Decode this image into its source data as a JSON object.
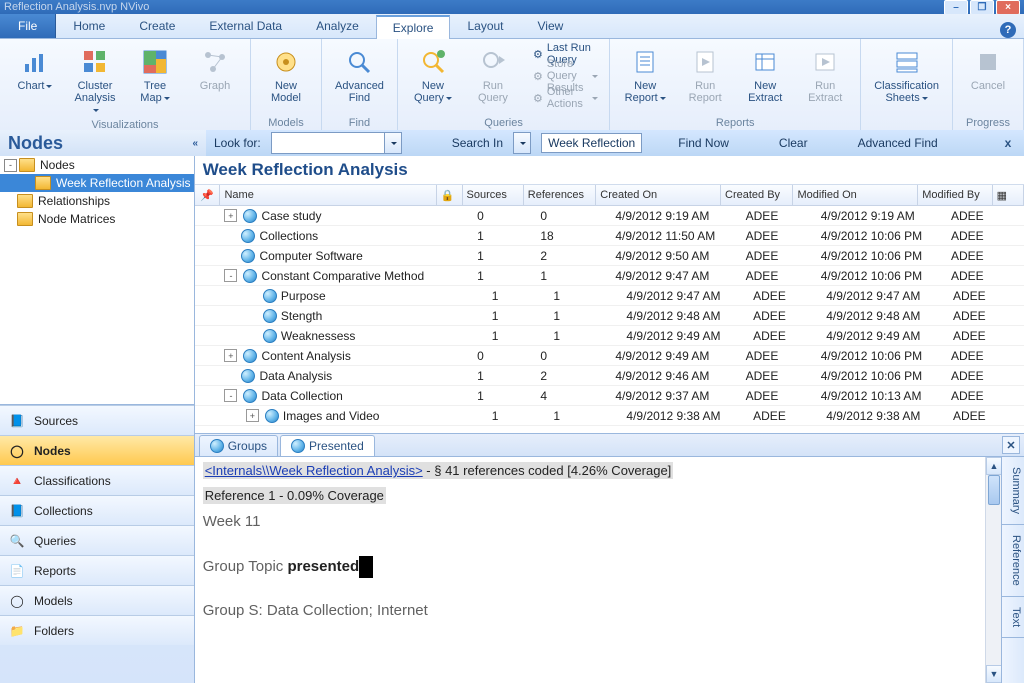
{
  "window": {
    "title_fragment": "Reflection Analysis.nvp   NVivo",
    "min": "–",
    "max": "❐",
    "close": "×"
  },
  "tabs": {
    "file": "File",
    "items": [
      "Home",
      "Create",
      "External Data",
      "Analyze",
      "Explore",
      "Layout",
      "View"
    ],
    "active_index": 4
  },
  "ribbon": {
    "groups": [
      {
        "name": "Visualizations",
        "buttons": [
          {
            "label": "Chart",
            "drop": true,
            "icon": "chart"
          },
          {
            "label": "Cluster\nAnalysis",
            "drop": true,
            "icon": "cluster"
          },
          {
            "label": "Tree\nMap",
            "drop": true,
            "icon": "treemap"
          },
          {
            "label": "Graph",
            "drop": false,
            "icon": "graph",
            "disabled": true
          }
        ]
      },
      {
        "name": "Models",
        "buttons": [
          {
            "label": "New\nModel",
            "drop": false,
            "icon": "model"
          }
        ]
      },
      {
        "name": "Find",
        "buttons": [
          {
            "label": "Advanced\nFind",
            "drop": false,
            "icon": "find"
          }
        ]
      },
      {
        "name": "Queries",
        "buttons": [
          {
            "label": "New\nQuery",
            "drop": true,
            "icon": "newquery"
          },
          {
            "label": "Run\nQuery",
            "drop": false,
            "icon": "runquery",
            "disabled": true
          }
        ],
        "small": [
          {
            "label": "Last Run Query",
            "icon": "bolt"
          },
          {
            "label": "Store Query Results",
            "icon": "store",
            "drop": true,
            "disabled": true
          },
          {
            "label": "Other Actions",
            "icon": "gear",
            "drop": true,
            "disabled": true
          }
        ]
      },
      {
        "name": "Reports",
        "buttons": [
          {
            "label": "New\nReport",
            "drop": true,
            "icon": "report"
          },
          {
            "label": "Run\nReport",
            "drop": false,
            "icon": "runreport",
            "disabled": true
          },
          {
            "label": "New\nExtract",
            "drop": false,
            "icon": "extract"
          },
          {
            "label": "Run\nExtract",
            "drop": false,
            "icon": "runextract",
            "disabled": true
          }
        ]
      },
      {
        "name": "",
        "buttons": [
          {
            "label": "Classification\nSheets",
            "drop": true,
            "icon": "class"
          }
        ]
      },
      {
        "name": "Progress",
        "buttons": [
          {
            "label": "Cancel",
            "drop": false,
            "icon": "cancel",
            "disabled": true
          }
        ]
      }
    ]
  },
  "findbar": {
    "lookfor_label": "Look for:",
    "lookfor_value": "",
    "searchin_label": "Search In",
    "scope": "Week Reflection",
    "findnow": "Find Now",
    "clear": "Clear",
    "advanced": "Advanced Find",
    "close": "x"
  },
  "leftnav": {
    "heading": "Nodes",
    "tree": [
      {
        "label": "Nodes",
        "level": 0,
        "expander": "-"
      },
      {
        "label": "Week Reflection Analysis",
        "level": 1,
        "selected": true
      },
      {
        "label": "Relationships",
        "level": 0,
        "expander": ""
      },
      {
        "label": "Node Matrices",
        "level": 0,
        "expander": ""
      }
    ],
    "panes": [
      {
        "label": "Sources",
        "icon": "📘"
      },
      {
        "label": "Nodes",
        "icon": "◯",
        "selected": true
      },
      {
        "label": "Classifications",
        "icon": "🔺"
      },
      {
        "label": "Collections",
        "icon": "📘"
      },
      {
        "label": "Queries",
        "icon": "🔍"
      },
      {
        "label": "Reports",
        "icon": "📄"
      },
      {
        "label": "Models",
        "icon": "◯"
      },
      {
        "label": "Folders",
        "icon": "📁"
      }
    ]
  },
  "content": {
    "title": "Week Reflection Analysis",
    "columns": [
      "Name",
      "Sources",
      "References",
      "Created On",
      "Created By",
      "Modified On",
      "Modified By"
    ],
    "rows": [
      {
        "indent": 0,
        "twist": "+",
        "name": "Case study",
        "src": "0",
        "ref": "0",
        "con": "4/9/2012 9:19 AM",
        "cby": "ADEE",
        "mon": "4/9/2012 9:19 AM",
        "mby": "ADEE"
      },
      {
        "indent": 0,
        "twist": "",
        "name": "Collections",
        "src": "1",
        "ref": "18",
        "con": "4/9/2012 11:50 AM",
        "cby": "ADEE",
        "mon": "4/9/2012 10:06 PM",
        "mby": "ADEE"
      },
      {
        "indent": 0,
        "twist": "",
        "name": "Computer Software",
        "src": "1",
        "ref": "2",
        "con": "4/9/2012 9:50 AM",
        "cby": "ADEE",
        "mon": "4/9/2012 10:06 PM",
        "mby": "ADEE"
      },
      {
        "indent": 0,
        "twist": "-",
        "name": "Constant Comparative Method",
        "src": "1",
        "ref": "1",
        "con": "4/9/2012 9:47 AM",
        "cby": "ADEE",
        "mon": "4/9/2012 10:06 PM",
        "mby": "ADEE"
      },
      {
        "indent": 1,
        "twist": "",
        "name": "Purpose",
        "src": "1",
        "ref": "1",
        "con": "4/9/2012 9:47 AM",
        "cby": "ADEE",
        "mon": "4/9/2012 9:47 AM",
        "mby": "ADEE"
      },
      {
        "indent": 1,
        "twist": "",
        "name": "Stength",
        "src": "1",
        "ref": "1",
        "con": "4/9/2012 9:48 AM",
        "cby": "ADEE",
        "mon": "4/9/2012 9:48 AM",
        "mby": "ADEE"
      },
      {
        "indent": 1,
        "twist": "",
        "name": "Weaknessess",
        "src": "1",
        "ref": "1",
        "con": "4/9/2012 9:49 AM",
        "cby": "ADEE",
        "mon": "4/9/2012 9:49 AM",
        "mby": "ADEE"
      },
      {
        "indent": 0,
        "twist": "+",
        "name": "Content Analysis",
        "src": "0",
        "ref": "0",
        "con": "4/9/2012 9:49 AM",
        "cby": "ADEE",
        "mon": "4/9/2012 10:06 PM",
        "mby": "ADEE"
      },
      {
        "indent": 0,
        "twist": "",
        "name": "Data Analysis",
        "src": "1",
        "ref": "2",
        "con": "4/9/2012 9:46 AM",
        "cby": "ADEE",
        "mon": "4/9/2012 10:06 PM",
        "mby": "ADEE"
      },
      {
        "indent": 0,
        "twist": "-",
        "name": "Data Collection",
        "src": "1",
        "ref": "4",
        "con": "4/9/2012 9:37 AM",
        "cby": "ADEE",
        "mon": "4/9/2012 10:13 AM",
        "mby": "ADEE"
      },
      {
        "indent": 1,
        "twist": "+",
        "name": "Images and Video",
        "src": "1",
        "ref": "1",
        "con": "4/9/2012 9:38 AM",
        "cby": "ADEE",
        "mon": "4/9/2012 9:38 AM",
        "mby": "ADEE"
      }
    ]
  },
  "detail": {
    "tabs": [
      "Groups",
      "Presented"
    ],
    "active_index": 1,
    "source_link": "<Internals\\\\Week Reflection Analysis>",
    "source_suffix": " - § 41 references coded  [4.26% Coverage]",
    "ref_line": "Reference 1 - 0.09% Coverage",
    "week": "Week 11",
    "topic_prefix": "Group Topic ",
    "topic_bold": "presented",
    "group_line": "Group S: Data Collection; Internet",
    "sidetabs": [
      "Summary",
      "Reference",
      "Text"
    ]
  }
}
